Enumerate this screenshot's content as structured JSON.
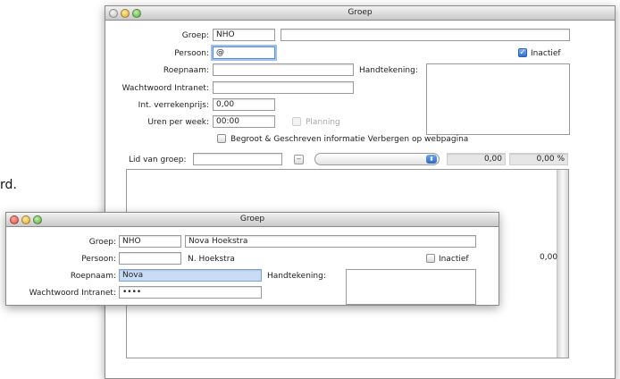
{
  "background_fragment": "rd.",
  "back_window": {
    "title": "Groep",
    "groep_label": "Groep:",
    "groep_value": "NHO",
    "groep_name": "",
    "persoon_label": "Persoon:",
    "persoon_value": "@",
    "inactief_label": "Inactief",
    "inactief_checked": true,
    "roepnaam_label": "Roepnaam:",
    "roepnaam_value": "",
    "handtekening_label": "Handtekening:",
    "wachtwoord_label": "Wachtwoord Intranet:",
    "wachtwoord_value": "",
    "verrekenprijs_label": "Int. verrekenprijs:",
    "verrekenprijs_value": "0,00",
    "uren_label": "Uren per week:",
    "uren_value": "00:00",
    "planning_label": "Planning",
    "begroot_label": "Begroot & Geschreven informatie Verbergen op webpagina",
    "lid_label": "Lid van groep:",
    "lid_value": "",
    "amount_value": "0,00",
    "percent_value": "0,00 %",
    "lower_amount": "0,00"
  },
  "front_window": {
    "title": "Groep",
    "groep_label": "Groep:",
    "groep_value": "NHO",
    "groep_name": "Nova Hoekstra",
    "persoon_label": "Persoon:",
    "persoon_value": "",
    "persoon_name": "N. Hoekstra",
    "inactief_label": "Inactief",
    "inactief_checked": false,
    "roepnaam_label": "Roepnaam:",
    "roepnaam_value": "Nova",
    "handtekening_label": "Handtekening:",
    "wachtwoord_label": "Wachtwoord Intranet:",
    "wachtwoord_value": "••••"
  }
}
